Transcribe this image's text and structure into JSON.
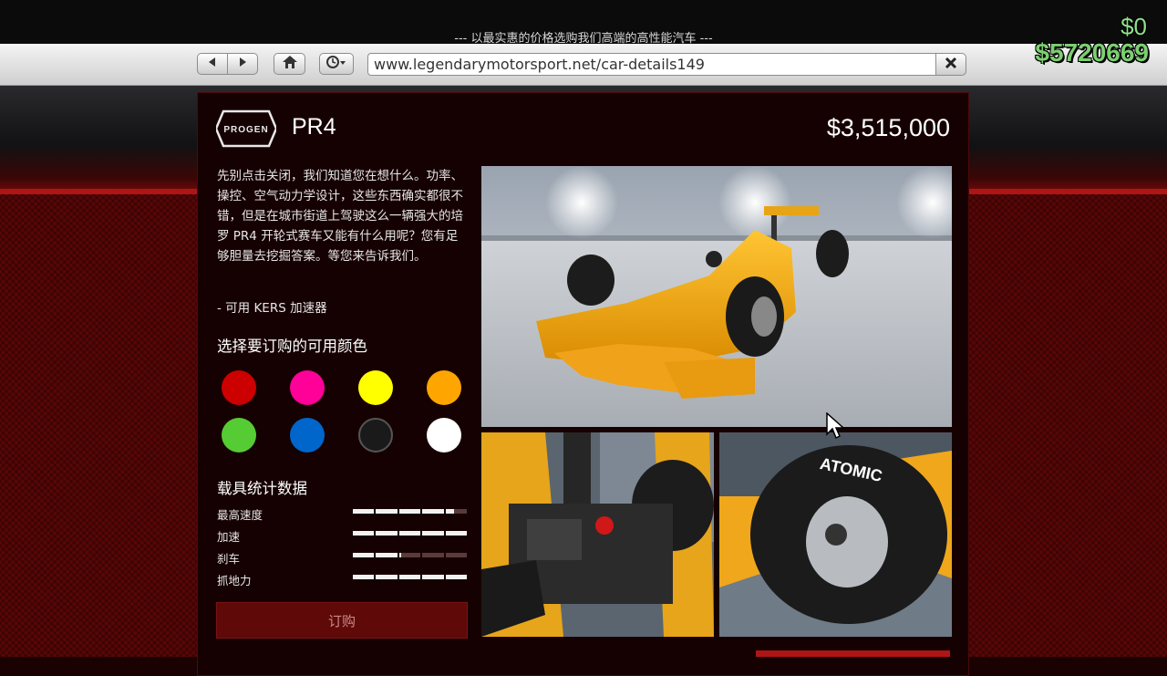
{
  "browser": {
    "tagline": "--- 以最实惠的价格选购我们高端的高性能汽车 ---",
    "url": "www.legendarymotorsport.net/car-details149",
    "back_icon": "back-arrow-icon",
    "forward_icon": "forward-arrow-icon",
    "home_icon": "home-icon",
    "history_icon": "clock-icon",
    "close_icon": "close-x-icon"
  },
  "hud": {
    "money_change": "$0",
    "money_total": "$5720669"
  },
  "vehicle": {
    "brand_logo": "PROGEN",
    "name": "PR4",
    "price": "$3,515,000",
    "description": "先别点击关闭，我们知道您在想什么。功率、操控、空气动力学设计，这些东西确实都很不错，但是在城市街道上驾驶这么一辆强大的培罗 PR4 开轮式赛车又能有什么用呢？您有足够胆量去挖掘答案。等您来告诉我们。",
    "feature": "- 可用 KERS 加速器"
  },
  "colors": {
    "heading": "选择要订购的可用颜色",
    "swatches": [
      "#cc0000",
      "#ff0099",
      "#ffff00",
      "#ffa500",
      "#55cc33",
      "#0066cc",
      "#1a1a1a",
      "#ffffff"
    ]
  },
  "stats": {
    "heading": "载具统计数据",
    "items": [
      {
        "label": "最高速度",
        "value": 0.88
      },
      {
        "label": "加速",
        "value": 1.0
      },
      {
        "label": "刹车",
        "value": 0.42
      },
      {
        "label": "抓地力",
        "value": 1.0
      }
    ]
  },
  "order_label": "订购",
  "photos": {
    "main_alt": "yellow open-wheel race car in showroom",
    "detail1_alt": "rear suspension detail",
    "detail2_alt": "ATOMIC tyre detail",
    "tyre_text": "ATOMIC"
  }
}
